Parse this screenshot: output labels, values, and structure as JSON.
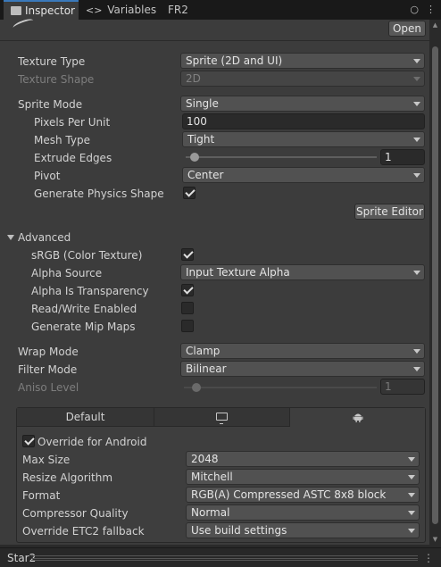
{
  "tabs": [
    {
      "label": "Inspector",
      "icon": "inspector-icon"
    },
    {
      "label": "Variables",
      "prefix": "<>"
    },
    {
      "label": "FR2"
    }
  ],
  "tab_actions": {
    "lock": "🔒",
    "menu": "⋮"
  },
  "header": {
    "open_label": "Open"
  },
  "fields": {
    "texture_type": {
      "label": "Texture Type",
      "value": "Sprite (2D and UI)"
    },
    "texture_shape": {
      "label": "Texture Shape",
      "value": "2D"
    },
    "sprite_mode": {
      "label": "Sprite Mode",
      "value": "Single"
    },
    "pixels_per_unit": {
      "label": "Pixels Per Unit",
      "value": "100"
    },
    "mesh_type": {
      "label": "Mesh Type",
      "value": "Tight"
    },
    "extrude_edges": {
      "label": "Extrude Edges",
      "value": "1",
      "slider_fraction": 0.03
    },
    "pivot": {
      "label": "Pivot",
      "value": "Center"
    },
    "generate_physics_shape": {
      "label": "Generate Physics Shape",
      "checked": true
    },
    "sprite_editor": {
      "label": "Sprite Editor"
    }
  },
  "advanced": {
    "title": "Advanced",
    "srgb": {
      "label": "sRGB (Color Texture)",
      "checked": true
    },
    "alpha_source": {
      "label": "Alpha Source",
      "value": "Input Texture Alpha"
    },
    "alpha_is_transparency": {
      "label": "Alpha Is Transparency",
      "checked": true
    },
    "read_write": {
      "label": "Read/Write Enabled",
      "checked": false
    },
    "mip_maps": {
      "label": "Generate Mip Maps",
      "checked": false
    }
  },
  "wrap": {
    "wrap_mode": {
      "label": "Wrap Mode",
      "value": "Clamp"
    },
    "filter_mode": {
      "label": "Filter Mode",
      "value": "Bilinear"
    },
    "aniso_level": {
      "label": "Aniso Level",
      "value": "1",
      "slider_fraction": 0.0
    }
  },
  "platform": {
    "tabs": [
      {
        "label": "Default"
      },
      {
        "icon": "monitor-icon"
      },
      {
        "icon": "android-icon"
      }
    ],
    "override": {
      "label": "Override for Android",
      "checked": true
    },
    "max_size": {
      "label": "Max Size",
      "value": "2048"
    },
    "resize_algorithm": {
      "label": "Resize Algorithm",
      "value": "Mitchell"
    },
    "format": {
      "label": "Format",
      "value": "RGB(A) Compressed ASTC 8x8 block"
    },
    "compressor_quality": {
      "label": "Compressor Quality",
      "value": "Normal"
    },
    "etc2_fallback": {
      "label": "Override ETC2 fallback",
      "value": "Use build settings"
    }
  },
  "status": {
    "title": "Star2",
    "menu": "⋮"
  },
  "colors": {
    "accent": "#3a79bb",
    "panel": "#3c3c3c",
    "field": "#515151"
  }
}
